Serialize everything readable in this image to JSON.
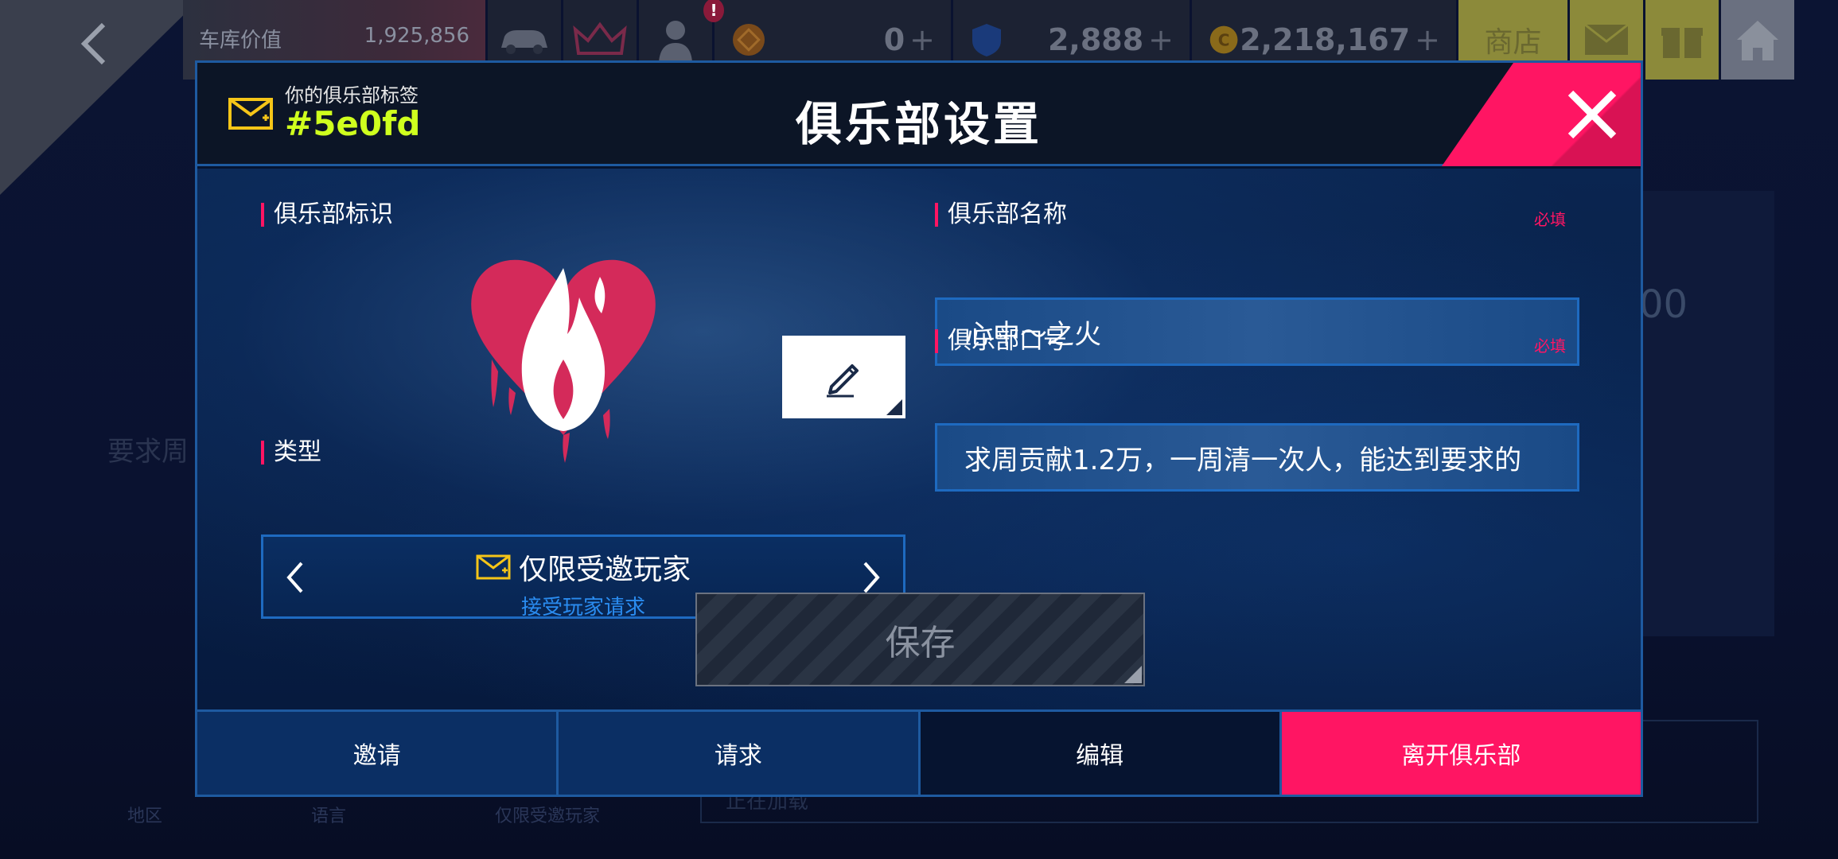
{
  "background": {
    "garage_label": "车库价值",
    "garage_value": "1,925,856",
    "badge": "!",
    "currency1_value": "0",
    "currency2_value": "2,888",
    "currency3_value": "2,218,167",
    "shop_label": "商店",
    "side_text": "要求周",
    "side_num": "00",
    "bottom_labels": [
      "地区",
      "语言",
      "仅限受邀玩家"
    ],
    "bottom_strip_text": "正在加载"
  },
  "dialog": {
    "tag_label": "你的俱乐部标签",
    "tag_value": "#5e0fd",
    "title": "俱乐部设置",
    "emblem_label": "俱乐部标识",
    "type_label": "类型",
    "type_value": "仅限受邀玩家",
    "type_sub": "接受玩家请求",
    "name_label": "俱乐部名称",
    "name_required": "必填",
    "name_value": "心中～之火",
    "motto_label": "俱乐部口号",
    "motto_required": "必填",
    "motto_value": "求周贡献1.2万，一周清一次人，能达到要求的",
    "save_label": "保存",
    "tabs": {
      "invite": "邀请",
      "requests": "请求",
      "edit": "编辑",
      "leave": "离开俱乐部"
    }
  },
  "colors": {
    "accent": "#ff1563",
    "tag": "#cfff1e",
    "border": "#1e5aa0",
    "emblem": "#d42a5a"
  }
}
